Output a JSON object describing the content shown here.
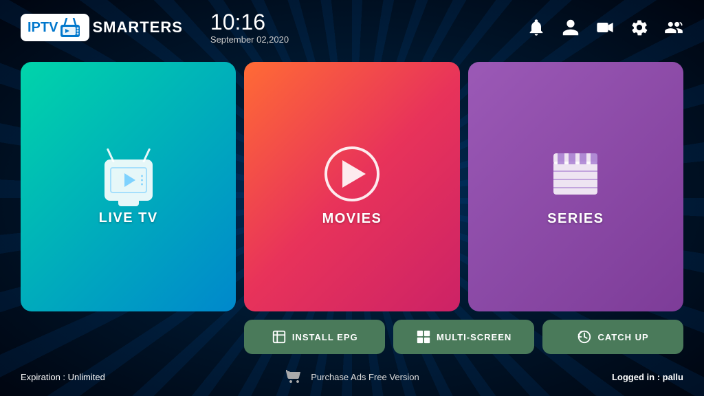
{
  "header": {
    "logo_iptv": "IPTV",
    "logo_smarters": "SMARTERS",
    "time": "10:16",
    "date": "September 02,2020",
    "icons": [
      "bell",
      "user",
      "rec",
      "settings",
      "multi-user"
    ]
  },
  "cards": [
    {
      "id": "live-tv",
      "label": "LIVE TV"
    },
    {
      "id": "movies",
      "label": "MOVIES"
    },
    {
      "id": "series",
      "label": "SERIES"
    }
  ],
  "buttons": [
    {
      "id": "install-epg",
      "label": "INSTALL EPG"
    },
    {
      "id": "multi-screen",
      "label": "MULTI-SCREEN"
    },
    {
      "id": "catch-up",
      "label": "CATCH UP"
    }
  ],
  "footer": {
    "expiry_label": "Expiration : ",
    "expiry_value": "Unlimited",
    "purchase_text": "Purchase Ads Free Version",
    "login_label": "Logged in : ",
    "login_user": "pallu"
  },
  "colors": {
    "live_tv_gradient_start": "#00d4aa",
    "live_tv_gradient_end": "#0088cc",
    "movies_gradient_start": "#ff6b35",
    "movies_gradient_end": "#cc2266",
    "series_gradient_start": "#9b59b6",
    "series_gradient_end": "#7d3c98",
    "button_bg": "#4a7a5a"
  }
}
